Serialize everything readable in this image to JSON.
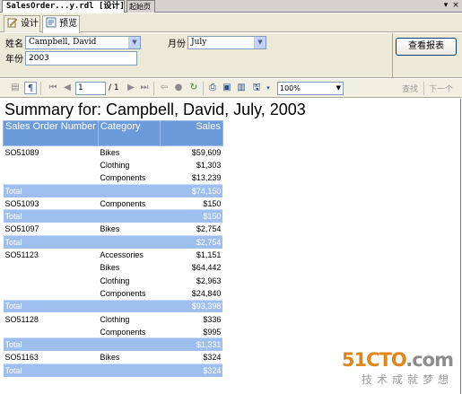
{
  "doc_tabs": {
    "active": "SalesOrder...y.rdl [设计]",
    "inactive": "起始页",
    "dropdown_glyph": "▾",
    "close_glyph": "×"
  },
  "view_tabs": {
    "design": "设计",
    "preview": "预览"
  },
  "params": {
    "name_label": "姓名",
    "name_value": "Campbell, David",
    "month_label": "月份",
    "month_value": "July",
    "year_label": "年份",
    "year_value": "2003",
    "view_report": "查看报表"
  },
  "toolbar": {
    "page_value": "1",
    "page_total": "/ 1",
    "zoom_value": "100%",
    "find_label": "查找",
    "next_label": "下一个"
  },
  "report": {
    "title": "Summary for: Campbell, David, July, 2003",
    "headers": {
      "order": "Sales Order Number",
      "category": "Category",
      "sales": "Sales"
    },
    "rows": [
      {
        "order": "SO51089",
        "category": "Bikes",
        "sales": "$59,609",
        "total": false
      },
      {
        "order": "",
        "category": "Clothing",
        "sales": "$1,303",
        "total": false
      },
      {
        "order": "",
        "category": "Components",
        "sales": "$13,239",
        "total": false
      },
      {
        "order": "Total",
        "category": "",
        "sales": "$74,150",
        "total": true
      },
      {
        "order": "SO51093",
        "category": "Components",
        "sales": "$150",
        "total": false
      },
      {
        "order": "Total",
        "category": "",
        "sales": "$150",
        "total": true
      },
      {
        "order": "SO51097",
        "category": "Bikes",
        "sales": "$2,754",
        "total": false
      },
      {
        "order": "Total",
        "category": "",
        "sales": "$2,754",
        "total": true
      },
      {
        "order": "SO51123",
        "category": "Accessories",
        "sales": "$1,151",
        "total": false
      },
      {
        "order": "",
        "category": "Bikes",
        "sales": "$64,442",
        "total": false
      },
      {
        "order": "",
        "category": "Clothing",
        "sales": "$2,963",
        "total": false
      },
      {
        "order": "",
        "category": "Components",
        "sales": "$24,840",
        "total": false
      },
      {
        "order": "Total",
        "category": "",
        "sales": "$93,398",
        "total": true
      },
      {
        "order": "SO51128",
        "category": "Clothing",
        "sales": "$336",
        "total": false
      },
      {
        "order": "",
        "category": "Components",
        "sales": "$995",
        "total": false
      },
      {
        "order": "Total",
        "category": "",
        "sales": "$1,331",
        "total": true
      },
      {
        "order": "SO51163",
        "category": "Bikes",
        "sales": "$324",
        "total": false
      },
      {
        "order": "Total",
        "category": "",
        "sales": "$324",
        "total": true
      }
    ]
  },
  "watermark": {
    "brand_a": "51CTO",
    "brand_b": ".com",
    "tagline": "技术成就梦想",
    "color_a": "#e0861c",
    "color_b": "#8c8c8c"
  },
  "colors": {
    "header_bg": "#6c9bdb",
    "total_bg": "#9ebfee",
    "panel_bg": "#ece9d8"
  }
}
